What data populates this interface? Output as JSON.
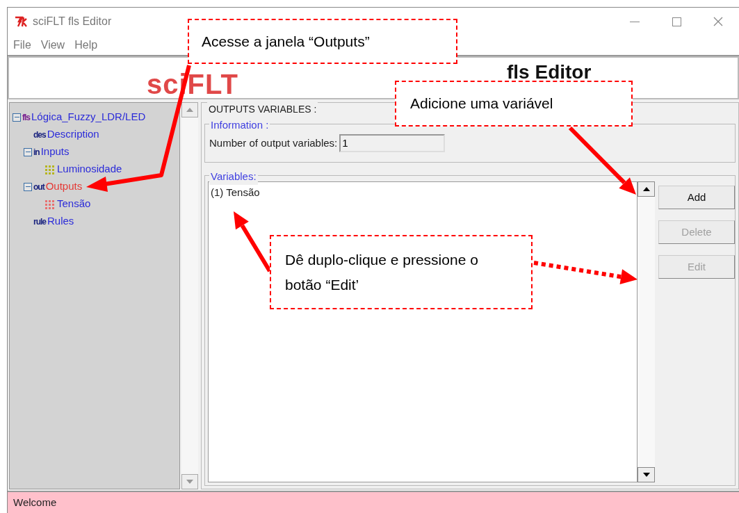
{
  "window": {
    "title": "sciFLT fls Editor"
  },
  "menu": [
    "File",
    "View",
    "Help"
  ],
  "banner": {
    "logo": "sciFLT",
    "title": "fls Editor"
  },
  "tree": [
    {
      "label": "Lógica_Fuzzy_LDR/LED",
      "badge": "fls",
      "expanded": true,
      "selected": false,
      "children": [
        {
          "label": "Description",
          "badge": "des",
          "selected": false
        },
        {
          "label": "Inputs",
          "badge": "in",
          "expanded": true,
          "selected": false,
          "children": [
            {
              "label": "Luminosidade",
              "color": "#b5b520",
              "selected": false
            }
          ]
        },
        {
          "label": "Outputs",
          "badge": "out",
          "expanded": true,
          "selected": true,
          "children": [
            {
              "label": "Tensão",
              "color": "#e87070",
              "selected": false
            }
          ]
        },
        {
          "label": "Rules",
          "badge": "rule",
          "selected": false
        }
      ]
    }
  ],
  "panel": {
    "title": "OUTPUTS VARIABLES :",
    "information": {
      "title": "Information :",
      "label": "Number of output variables:",
      "value": "1"
    },
    "variables": {
      "title": "Variables:",
      "items": [
        {
          "label": "(1) Tensão",
          "selected": false
        }
      ]
    },
    "buttons": [
      {
        "label": "Add",
        "disabled": false
      },
      {
        "label": "Delete",
        "disabled": true
      },
      {
        "label": "Edit",
        "disabled": true
      }
    ]
  },
  "status_bar": "Welcome",
  "callouts": [
    "Acesse a janela “Outputs”",
    "Adicione uma variável",
    "Dê duplo-clique e pressione o botão “Edit’"
  ]
}
